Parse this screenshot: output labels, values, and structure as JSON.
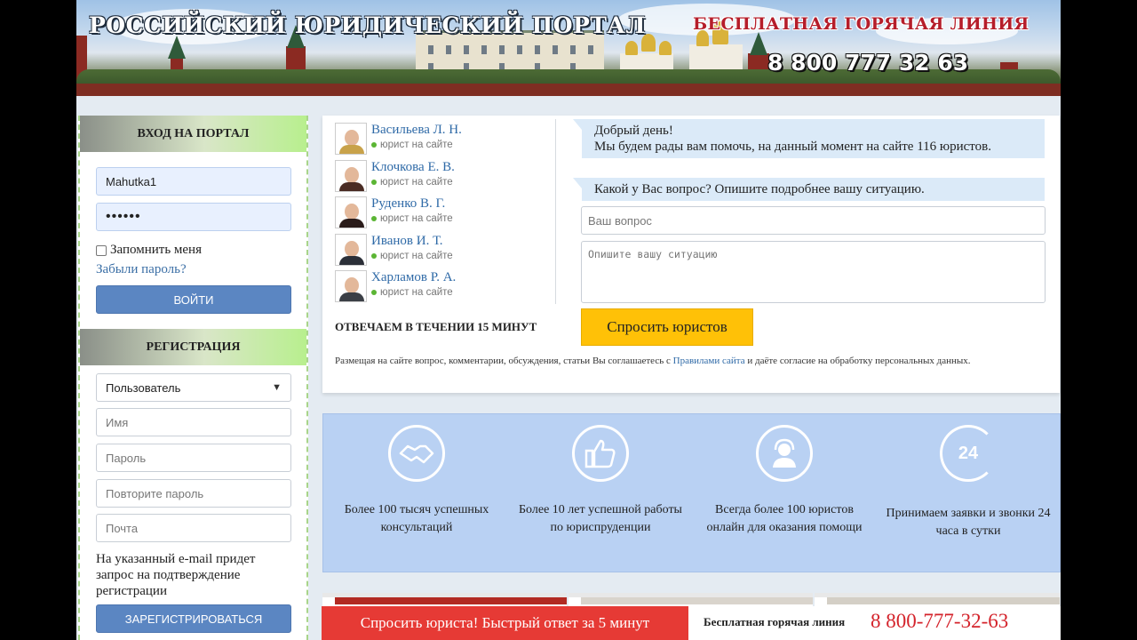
{
  "header": {
    "portal_title": "РОССИЙСКИЙ ЮРИДИЧЕСКИЙ ПОРТАЛ",
    "hotline_title": "БЕСПЛАТНАЯ ГОРЯЧАЯ ЛИНИЯ",
    "hotline_phone": "8 800 777 32 63"
  },
  "login": {
    "heading": "ВХОД НА ПОРТАЛ",
    "username_value": "Mahutka1",
    "password_value": "••••••",
    "remember_label": "Запомнить меня",
    "forgot_link": "Забыли пароль?",
    "submit_label": "ВОЙТИ"
  },
  "registration": {
    "heading": "РЕГИСТРАЦИЯ",
    "role_selected": "Пользователь",
    "name_placeholder": "Имя",
    "password_placeholder": "Пароль",
    "password_repeat_placeholder": "Повторите пароль",
    "email_placeholder": "Почта",
    "note": "На указанный e-mail придет запрос на подтверждение регистрации",
    "submit_label": "ЗАРЕГИСТРИРОВАТЬСЯ"
  },
  "lawyers": {
    "status": "юрист на сайте",
    "items": [
      {
        "name": "Васильева Л. Н.",
        "color": "#c8a24a"
      },
      {
        "name": "Клочкова Е. В.",
        "color": "#4a2c24"
      },
      {
        "name": "Руденко В. Г.",
        "color": "#2a1c1a"
      },
      {
        "name": "Иванов И. Т.",
        "color": "#2b2f38"
      },
      {
        "name": "Харламов Р. А.",
        "color": "#3b3f46"
      }
    ],
    "answer_time": "ОТВЕЧАЕМ В ТЕЧЕНИИ 15 МИНУТ"
  },
  "chat": {
    "greeting_line1": "Добрый день!",
    "greeting_line2": "Мы будем рады вам помочь, на данный момент на сайте 116 юристов.",
    "prompt": "Какой у Вас вопрос? Опишите подробнее вашу ситуацию.",
    "question_placeholder": "Ваш вопрос",
    "situation_placeholder": "Опишите вашу ситуацию",
    "ask_button": "Спросить юристов",
    "terms_before": "Размещая на сайте вопрос, комментарии, обсуждения, статьи Вы соглашаетесь с",
    "terms_link": "Правилами сайта",
    "terms_after": "и даёте согласие на обработку персональных данных."
  },
  "features": [
    {
      "icon": "handshake-icon",
      "text": "Более 100 тысяч успешных консультаций"
    },
    {
      "icon": "thumbs-up-icon",
      "text": "Более 10 лет успешной работы по юриспруденции"
    },
    {
      "icon": "support-operator-icon",
      "text": "Всегда более 100 юристов онлайн для оказания помощи"
    },
    {
      "icon": "clock-24-icon",
      "text": "Принимаем заявки и звонки 24 часа в сутки",
      "badge": "24"
    }
  ],
  "bottom_bar": {
    "ask_label": "Спросить юриста! Быстрый ответ за 5 минут",
    "hotline_label": "Бесплатная горячая линия",
    "hotline_phone": "8 800-777-32-63"
  },
  "colors": {
    "accent_blue": "#5b86c2",
    "ask_yellow": "#ffc107",
    "alert_red": "#e63a35",
    "feature_bg": "#b9d1f3",
    "online_green": "#5bb534"
  }
}
